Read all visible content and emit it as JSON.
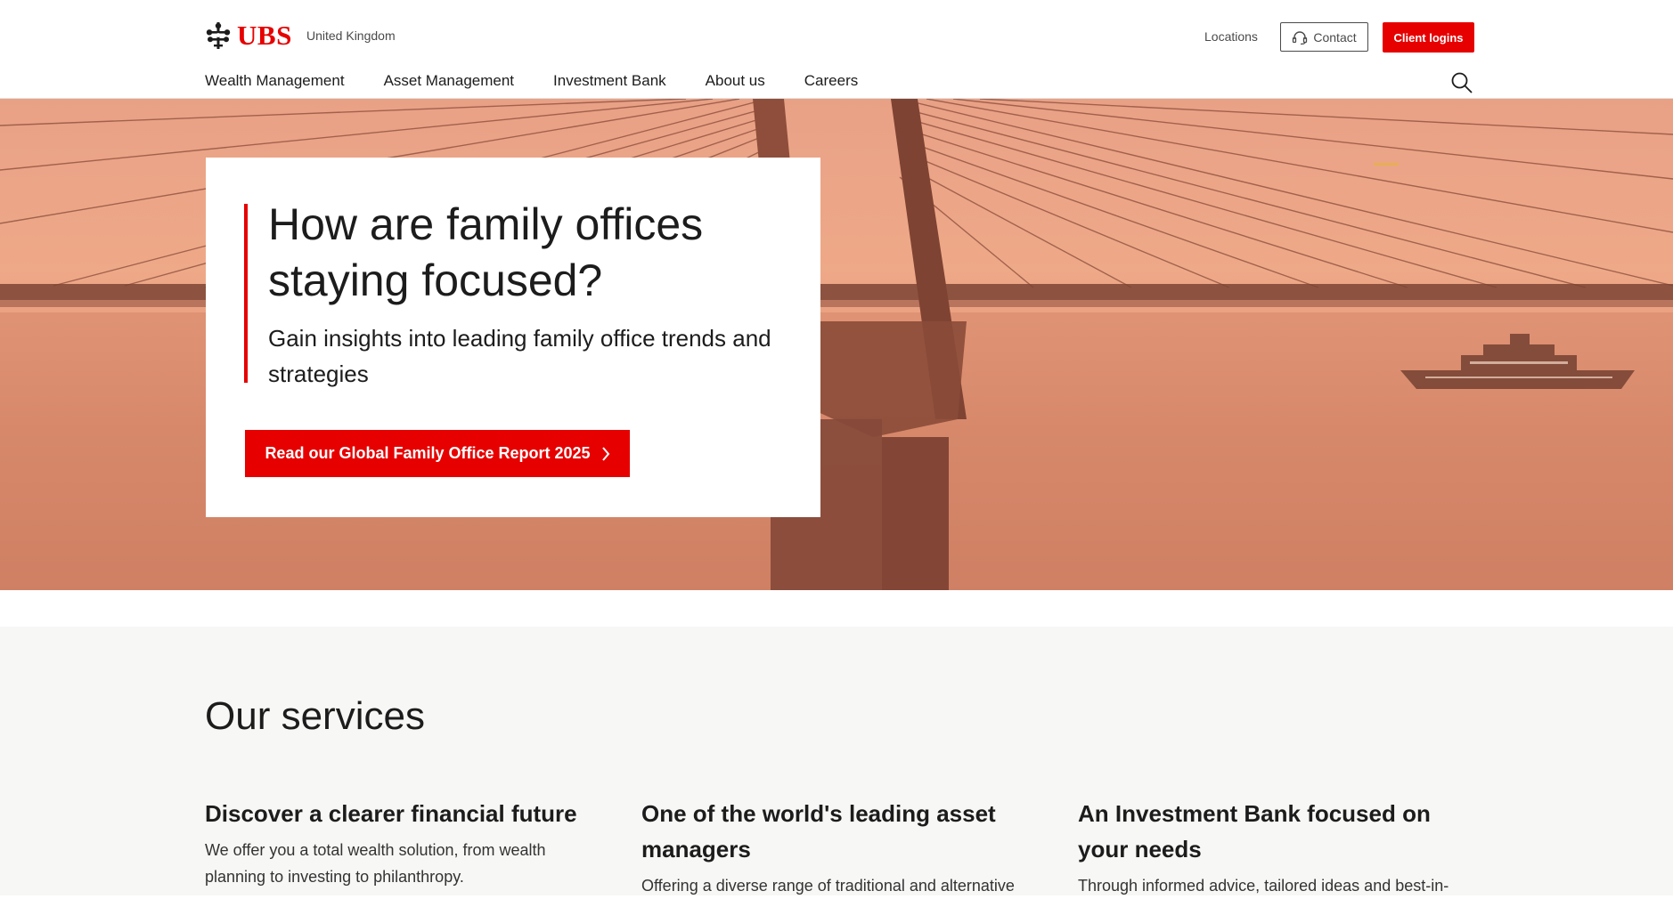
{
  "brand": {
    "logo_text": "UBS",
    "accent": "#e60000"
  },
  "header": {
    "region": "United Kingdom",
    "locations": "Locations",
    "contact": "Contact",
    "client_logins": "Client logins"
  },
  "nav": {
    "items": [
      "Wealth Management",
      "Asset Management",
      "Investment Bank",
      "About us",
      "Careers"
    ]
  },
  "hero": {
    "title": "How are family offices staying focused?",
    "subtitle": "Gain insights into leading family office trends and strategies",
    "cta": "Read our Global Family Office Report 2025"
  },
  "services": {
    "title": "Our services",
    "cards": [
      {
        "title": "Discover a clearer financial future",
        "text": "We offer you a total wealth solution, from wealth planning to investing to philanthropy."
      },
      {
        "title": "One of the world's leading asset managers",
        "text": "Offering a diverse range of traditional and alternative"
      },
      {
        "title": "An Investment Bank focused on your needs",
        "text": "Through informed advice, tailored ideas and best-in-"
      }
    ]
  },
  "icons": [
    "ubs-keys-logo-icon",
    "headset-icon",
    "search-icon",
    "chevron-right-icon"
  ]
}
